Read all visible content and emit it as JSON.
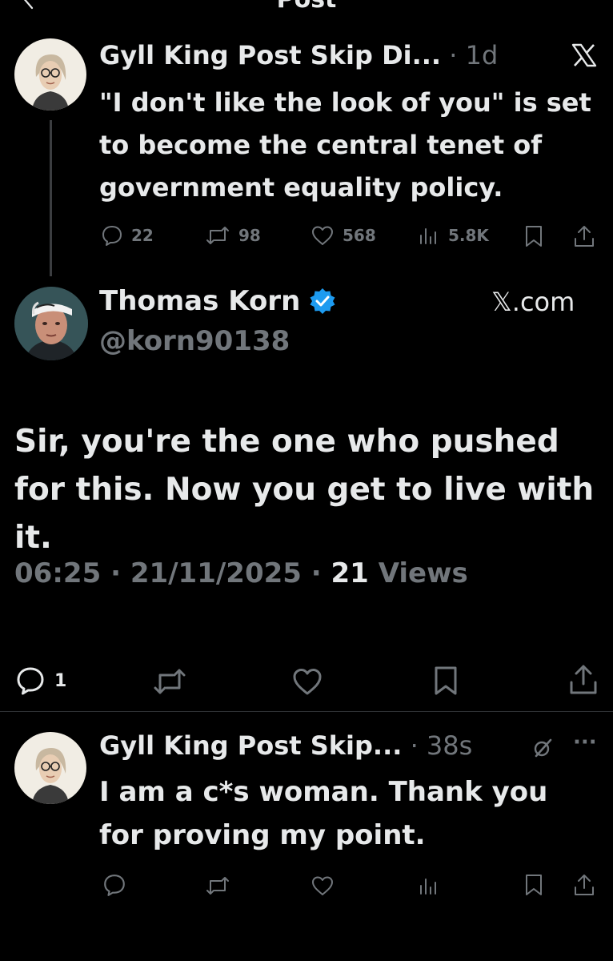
{
  "header": {
    "title": "Post"
  },
  "parent_post": {
    "author_name": "Gyll King Post Skip Di...",
    "time": "1d",
    "text": "\"I don't like the look of you\" is set to become the central tenet of government equality policy.",
    "platform_icon": "x-logo",
    "stats": {
      "replies": "22",
      "reposts": "98",
      "likes": "568",
      "views": "5.8K"
    }
  },
  "quoted_post": {
    "author_name": "Thomas Korn",
    "handle": "@korn90138",
    "verified": true,
    "source": "𝕏.com",
    "text": "Sir, you're the one who pushed for this. Now you get to live with it.",
    "time": "06:25",
    "date": "21/11/2025",
    "views_count": "21",
    "views_label": "Views",
    "actions": {
      "replies": "1"
    }
  },
  "reply_post": {
    "author_name": "Gyll King Post Skip...",
    "time": "38s",
    "text": "I am a c*s woman. Thank you for proving my point.",
    "more": "···"
  },
  "colors": {
    "background": "#000000",
    "text": "#e7e9ea",
    "muted": "#71767b",
    "verified": "#1d9bf0"
  }
}
